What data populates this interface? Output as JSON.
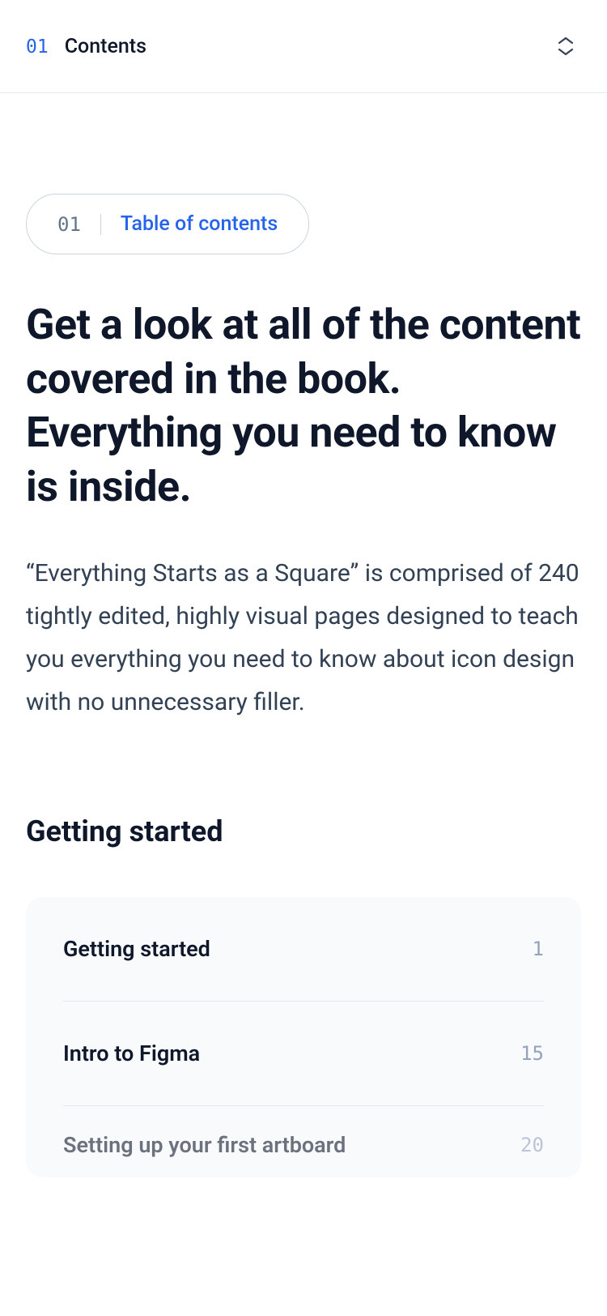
{
  "topbar": {
    "number": "01",
    "label": "Contents"
  },
  "badge": {
    "number": "01",
    "label": "Table of contents"
  },
  "heading": "Get a look at all of the content covered in the book. Everything you need to know is inside.",
  "paragraph": "“Everything Starts as a Square” is comprised of 240 tightly edited, highly visual pages designed to teach you everything you need to know about icon design with no unnecessary filler.",
  "section": {
    "title": "Getting started",
    "items": [
      {
        "title": "Getting started",
        "page": "1"
      },
      {
        "title": "Intro to Figma",
        "page": "15"
      },
      {
        "title": "Setting up your first artboard",
        "page": "20"
      }
    ]
  }
}
